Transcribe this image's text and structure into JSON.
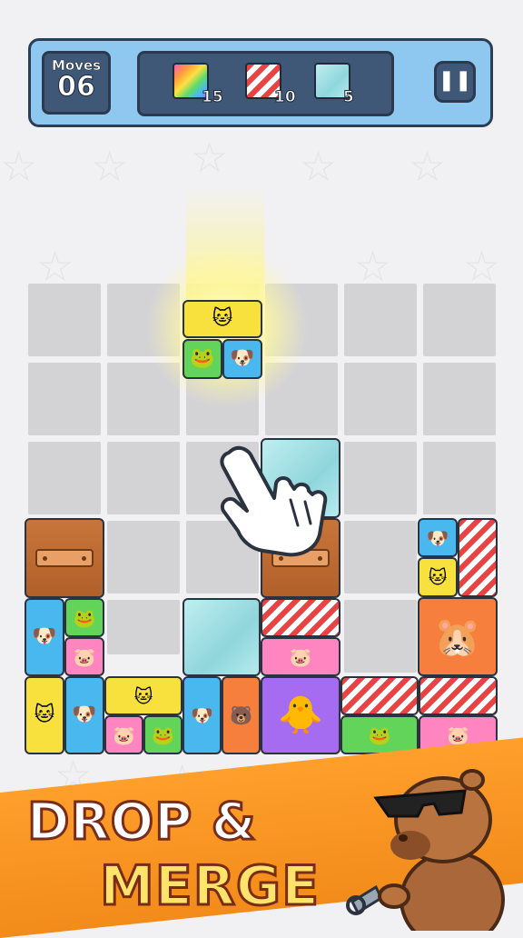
{
  "hud": {
    "moves_label": "Moves",
    "moves_value": "06",
    "goals": [
      {
        "type": "rainbow",
        "count": "15"
      },
      {
        "type": "stripe",
        "count": "10"
      },
      {
        "type": "glass",
        "count": "5"
      }
    ],
    "pause_icon": "pause-icon"
  },
  "board": {
    "columns": 6,
    "rows": 6
  },
  "banner": {
    "line1": "DROP &",
    "line2": "MERGE"
  },
  "colors": {
    "hud_bg": "#8ec8f0",
    "panel": "#3f5878",
    "banner": "#f28b1a"
  }
}
